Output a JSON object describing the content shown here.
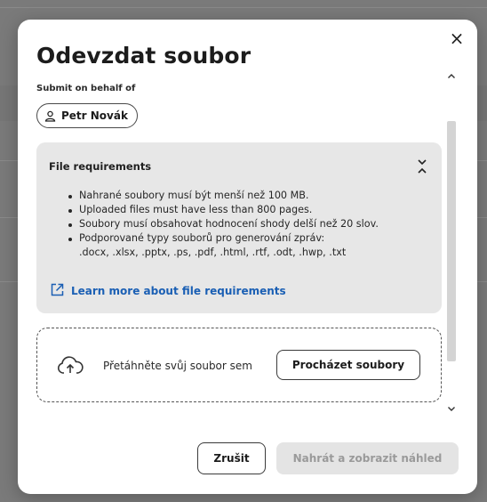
{
  "dialog": {
    "title": "Odevzdat soubor",
    "close_label": "×"
  },
  "behalf": {
    "label": "Submit on behalf of",
    "user_name": "Petr Novák"
  },
  "requirements": {
    "title": "File requirements",
    "items": [
      "Nahrané soubory musí být menší než 100 MB.",
      "Uploaded files must have less than 800 pages.",
      "Soubory musí obsahovat hodnocení shody delší než 20 slov.",
      "Podporované typy souborů pro generování zpráv:"
    ],
    "file_types": ".docx, .xlsx, .pptx, .ps, .pdf, .html, .rtf, .odt, .hwp, .txt",
    "learn_more": "Learn more about file requirements"
  },
  "dropzone": {
    "text": "Přetáhněte svůj soubor sem",
    "browse_label": "Procházet soubory"
  },
  "footer": {
    "cancel_label": "Zrušit",
    "submit_label": "Nahrát a zobrazit náhled"
  },
  "colors": {
    "link": "#1a5fb4",
    "panel_bg": "#e7e7e7",
    "disabled_bg": "#e4e4e4"
  }
}
